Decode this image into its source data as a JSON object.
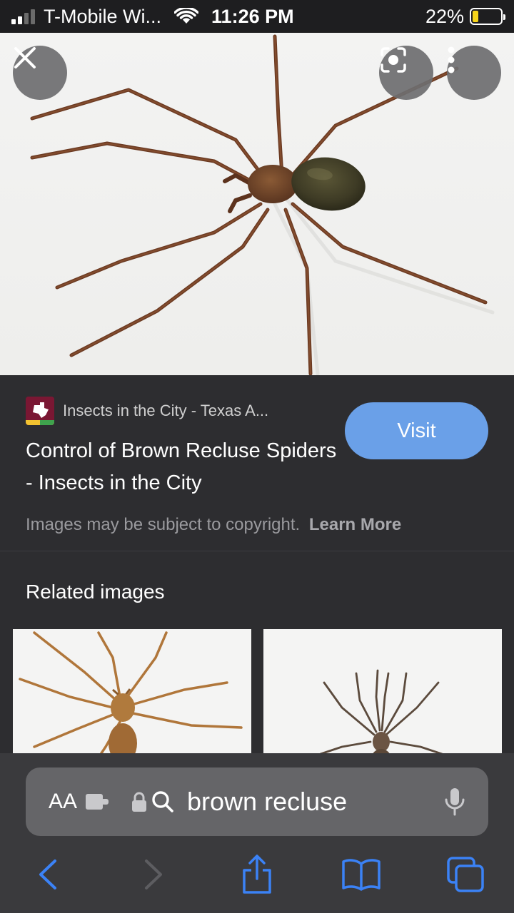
{
  "status_bar": {
    "carrier": "T-Mobile Wi...",
    "time": "11:26 PM",
    "battery_percent": "22%",
    "battery_level": 0.22,
    "icons": [
      "signal-icon",
      "wifi-icon",
      "battery-icon"
    ]
  },
  "viewer": {
    "icons": [
      "close-icon",
      "lens-search-icon",
      "more-options-icon"
    ]
  },
  "result": {
    "source": "Insects in the City - Texas A...",
    "title": "Control of Brown Recluse Spiders - Insects in the City",
    "visit_label": "Visit",
    "copyright_text": "Images may be subject to copyright.",
    "learn_more_label": "Learn More"
  },
  "related": {
    "heading": "Related images"
  },
  "safari": {
    "aa_label": "AA",
    "query": "brown recluse",
    "icons": [
      "extension-icon",
      "lock-icon",
      "search-icon",
      "microphone-icon",
      "back-icon",
      "forward-icon",
      "share-icon",
      "bookmarks-icon",
      "tabs-icon"
    ]
  },
  "colors": {
    "accent_blue": "#6aa0e8",
    "toolbar_blue": "#3b82f6",
    "panel_bg": "#2d2d30",
    "battery_yellow": "#f7d51a"
  }
}
